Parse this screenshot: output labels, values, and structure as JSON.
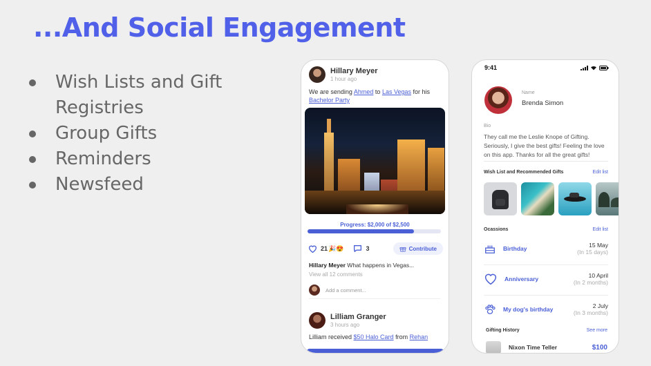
{
  "slide": {
    "title": "...And Social Engagement",
    "bullets": [
      "Wish Lists and Gift Registries",
      "Group Gifts",
      "Reminders",
      "Newsfeed"
    ]
  },
  "feed": {
    "post1": {
      "author": "Hillary Meyer",
      "time": "1 hour ago",
      "text_a": "We are sending ",
      "link_a": "Ahmed",
      "text_b": " to ",
      "link_b": "Las Vegas",
      "text_c": " for his ",
      "link_c": "Bachelor Party",
      "progress_label": "Progress: $2,000 of $2,500",
      "progress_fraction": 0.8,
      "likes": "21",
      "comments": "3",
      "contribute_label": "Contribute",
      "top_comment_author": "Hillary Meyer",
      "top_comment_text": "What happens in Vegas...",
      "view_all": "View all 12 comments",
      "add_comment_placeholder": "Add a comment..."
    },
    "post2": {
      "author": "Lilliam Granger",
      "time": "3 hours ago",
      "text_a": "Lilliam received ",
      "link_a": "$50 Halo Card",
      "text_b": " from ",
      "link_b": "Rehan"
    }
  },
  "profile": {
    "status_time": "9:41",
    "name_label": "Name",
    "name": "Brenda Simon",
    "bio_label": "Bio",
    "bio": "They call me the Leslie Knope of Gifting. Seriously, I give the best gifts! Feeling the love on this app. Thanks for all the great gifts!",
    "wishlist_heading": "Wish List and Recommended Gifts",
    "wishlist_edit": "Edit list",
    "occasions_heading": "Ocassions",
    "occasions_edit": "Edit list",
    "occasions": [
      {
        "label": "Birthday",
        "date": "15 May",
        "relative": "(In 15 days)",
        "icon": "cake-icon"
      },
      {
        "label": "Anniversary",
        "date": "10 April",
        "relative": "(In 2 months)",
        "icon": "heart-icon"
      },
      {
        "label": "My dog's birthday",
        "date": "2 July",
        "relative": "(In 3 months)",
        "icon": "paw-icon"
      }
    ],
    "history_heading": "Gifting History",
    "history_more": "See more",
    "history_item": {
      "name": "Nixon Time Teller",
      "price": "$100"
    }
  },
  "colors": {
    "accent": "#4a5fd6",
    "title": "#5060e8"
  }
}
